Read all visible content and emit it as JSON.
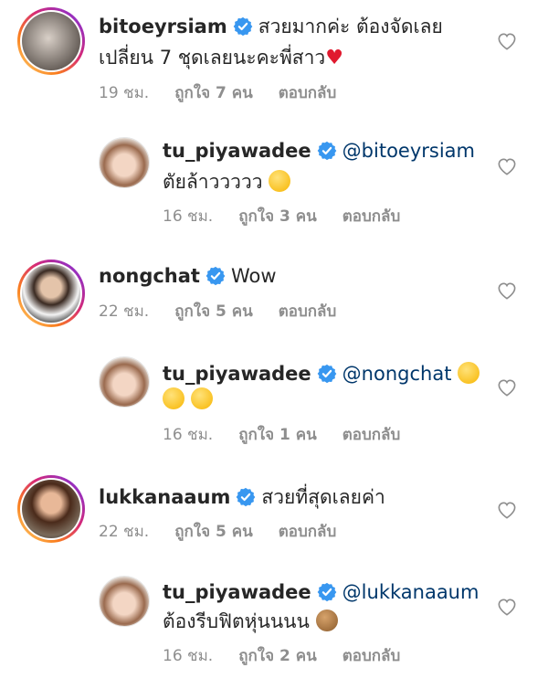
{
  "comments": [
    {
      "username": "bitoeyrsiam",
      "text_line1": "สวยมากค่ะ ต้องจัดเลย",
      "text_line2": "เปลี่ยน 7 ชุดเลยนะคะพี่สาว",
      "heart_emoji": "♥",
      "time": "19 ชม.",
      "likes": "ถูกใจ 7 คน",
      "reply": "ตอบกลับ"
    },
    {
      "username": "tu_piyawadee",
      "mention": "@bitoeyrsiam",
      "text": "ตัยล้าววววว",
      "emoji": "laughing-tears",
      "time": "16 ชม.",
      "likes": "ถูกใจ 3 คน",
      "reply": "ตอบกลับ"
    },
    {
      "username": "nongchat",
      "text": "Wow",
      "time": "22 ชม.",
      "likes": "ถูกใจ 5 คน",
      "reply": "ตอบกลับ"
    },
    {
      "username": "tu_piyawadee",
      "mention": "@nongchat",
      "emoji": "laughing-squint",
      "time": "16 ชม.",
      "likes": "ถูกใจ 1 คน",
      "reply": "ตอบกลับ"
    },
    {
      "username": "lukkanaaum",
      "text": "สวยที่สุดเลยค่า",
      "time": "22 ชม.",
      "likes": "ถูกใจ 5 คน",
      "reply": "ตอบกลับ"
    },
    {
      "username": "tu_piyawadee",
      "mention": "@lukkanaaum",
      "text": "ต้องรีบฟิตหุ่นนนน",
      "emoji": "see-no-evil-monkey",
      "time": "16 ชม.",
      "likes": "ถูกใจ 2 คน",
      "reply": "ตอบกลับ"
    }
  ],
  "colors": {
    "verified": "#3897f0",
    "mention": "#00376b",
    "meta": "#8e8e8e",
    "heart_red": "#e0192e"
  }
}
